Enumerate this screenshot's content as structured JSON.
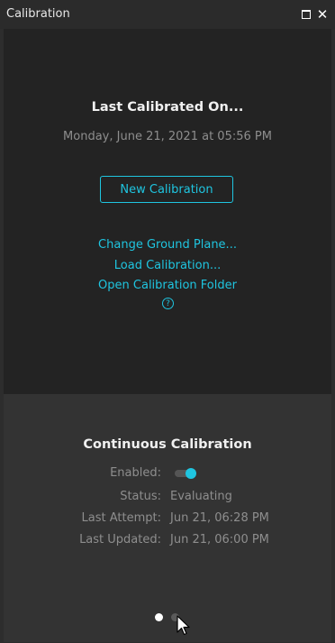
{
  "window": {
    "title": "Calibration",
    "maximize_icon": "maximize-icon",
    "close_icon": "close-icon",
    "close_glyph": "✕"
  },
  "last_calibration": {
    "heading": "Last Calibrated On...",
    "date": "Monday, June 21, 2021 at 05:56 PM",
    "new_button": "New Calibration",
    "links": [
      "Change Ground Plane...",
      "Load Calibration...",
      "Open Calibration Folder"
    ],
    "help_glyph": "?"
  },
  "continuous": {
    "heading": "Continuous Calibration",
    "rows": [
      {
        "label": "Enabled:",
        "value": ""
      },
      {
        "label": "Status:",
        "value": "Evaluating"
      },
      {
        "label": "Last Attempt:",
        "value": "Jun 21, 06:28 PM"
      },
      {
        "label": "Last Updated:",
        "value": "Jun 21, 06:00 PM"
      }
    ],
    "enabled": true
  },
  "pager": {
    "pages": 2,
    "active_page": 1
  },
  "colors": {
    "accent": "#1fc5e0",
    "panel_top": "#232323",
    "panel_bottom": "#333333",
    "muted_text": "#8e8e8e"
  }
}
